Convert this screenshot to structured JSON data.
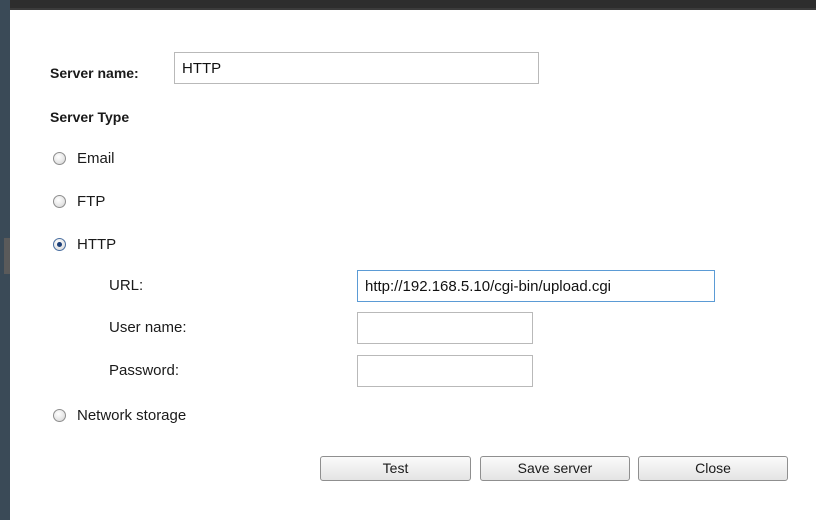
{
  "form": {
    "server_name_label": "Server name:",
    "server_name_value": "HTTP",
    "server_type_heading": "Server Type"
  },
  "server_types": {
    "email": {
      "label": "Email",
      "checked": false
    },
    "ftp": {
      "label": "FTP",
      "checked": false
    },
    "http": {
      "label": "HTTP",
      "checked": true
    },
    "network_storage": {
      "label": "Network storage",
      "checked": false
    }
  },
  "http_settings": {
    "url_label": "URL:",
    "url_value": "http://192.168.5.10/cgi-bin/upload.cgi",
    "username_label": "User name:",
    "username_value": "",
    "password_label": "Password:",
    "password_value": ""
  },
  "buttons": {
    "test": "Test",
    "save": "Save server",
    "close": "Close"
  },
  "colors": {
    "focus_border": "#5b9bd5",
    "dialog_background": "#ffffff",
    "backdrop": "#2d2d2d"
  }
}
